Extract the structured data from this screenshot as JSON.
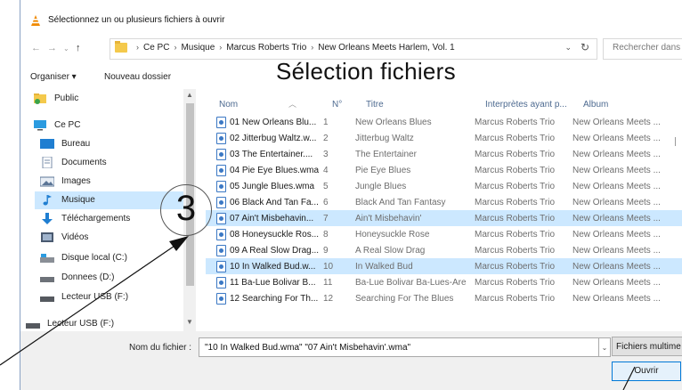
{
  "window": {
    "title": "Sélectionnez un ou plusieurs fichiers à ouvrir"
  },
  "address": {
    "crumbs": [
      "Ce PC",
      "Musique",
      "Marcus Roberts Trio",
      "New Orleans Meets Harlem, Vol. 1"
    ],
    "search_placeholder": "Rechercher dans"
  },
  "toolbar": {
    "organize_label": "Organiser ▾",
    "new_folder_label": "Nouveau dossier"
  },
  "annotation": {
    "overlay_title": "Sélection fichiers",
    "step_number": "3"
  },
  "sidebar": {
    "items": [
      {
        "label": "Public",
        "icon": "public-folder-icon"
      },
      {
        "label": "Ce PC",
        "icon": "computer-icon"
      },
      {
        "label": "Bureau",
        "icon": "desktop-icon"
      },
      {
        "label": "Documents",
        "icon": "documents-icon"
      },
      {
        "label": "Images",
        "icon": "images-icon"
      },
      {
        "label": "Musique",
        "icon": "music-note-icon",
        "selected": true
      },
      {
        "label": "Téléchargements",
        "icon": "download-arrow-icon"
      },
      {
        "label": "Vidéos",
        "icon": "videos-icon"
      },
      {
        "label": "Disque local (C:)",
        "icon": "local-disk-icon"
      },
      {
        "label": "Donnees (D:)",
        "icon": "drive-icon"
      },
      {
        "label": "Lecteur USB (F:)",
        "icon": "usb-drive-icon"
      },
      {
        "label": "Lecteur USB (F:)",
        "icon": "usb-drive-icon"
      }
    ]
  },
  "files": {
    "columns": [
      "Nom",
      "N°",
      "Titre",
      "Interprètes ayant p...",
      "Album"
    ],
    "rows": [
      {
        "name": "01 New Orleans Blu...",
        "num": "1",
        "title": "New Orleans Blues",
        "artist": "Marcus Roberts Trio",
        "album": "New Orleans Meets ...",
        "selected": false
      },
      {
        "name": "02 Jitterbug Waltz.w...",
        "num": "2",
        "title": "Jitterbug Waltz",
        "artist": "Marcus Roberts Trio",
        "album": "New Orleans Meets ...",
        "selected": false
      },
      {
        "name": "03 The Entertainer....",
        "num": "3",
        "title": "The Entertainer",
        "artist": "Marcus Roberts Trio",
        "album": "New Orleans Meets ...",
        "selected": false
      },
      {
        "name": "04 Pie Eye Blues.wma",
        "num": "4",
        "title": "Pie Eye Blues",
        "artist": "Marcus Roberts Trio",
        "album": "New Orleans Meets ...",
        "selected": false
      },
      {
        "name": "05 Jungle Blues.wma",
        "num": "5",
        "title": "Jungle Blues",
        "artist": "Marcus Roberts Trio",
        "album": "New Orleans Meets ...",
        "selected": false
      },
      {
        "name": "06 Black And Tan Fa...",
        "num": "6",
        "title": "Black And Tan Fantasy",
        "artist": "Marcus Roberts Trio",
        "album": "New Orleans Meets ...",
        "selected": false
      },
      {
        "name": "07 Ain't Misbehavin...",
        "num": "7",
        "title": "Ain't Misbehavin'",
        "artist": "Marcus Roberts Trio",
        "album": "New Orleans Meets ...",
        "selected": true
      },
      {
        "name": "08 Honeysuckle Ros...",
        "num": "8",
        "title": "Honeysuckle Rose",
        "artist": "Marcus Roberts Trio",
        "album": "New Orleans Meets ...",
        "selected": false
      },
      {
        "name": "09 A Real Slow Drag...",
        "num": "9",
        "title": "A Real Slow Drag",
        "artist": "Marcus Roberts Trio",
        "album": "New Orleans Meets ...",
        "selected": false
      },
      {
        "name": "10 In Walked Bud.w...",
        "num": "10",
        "title": "In Walked Bud",
        "artist": "Marcus Roberts Trio",
        "album": "New Orleans Meets ...",
        "selected": true
      },
      {
        "name": "11 Ba-Lue Bolivar B...",
        "num": "11",
        "title": "Ba-Lue Bolivar Ba-Lues-Are",
        "artist": "Marcus Roberts Trio",
        "album": "New Orleans Meets ...",
        "selected": false
      },
      {
        "name": "12 Searching For Th...",
        "num": "12",
        "title": "Searching For The Blues",
        "artist": "Marcus Roberts Trio",
        "album": "New Orleans Meets ...",
        "selected": false
      }
    ]
  },
  "bottom": {
    "filename_label": "Nom du fichier :",
    "filename_value": "\"10 In Walked Bud.wma\" \"07 Ain't Misbehavin'.wma\"",
    "filter_label": "Fichiers multime",
    "open_label": "Ouvrir"
  },
  "colors": {
    "selection": "#cce8ff",
    "header_text": "#4d6a90",
    "open_button_border": "#0078d7"
  }
}
